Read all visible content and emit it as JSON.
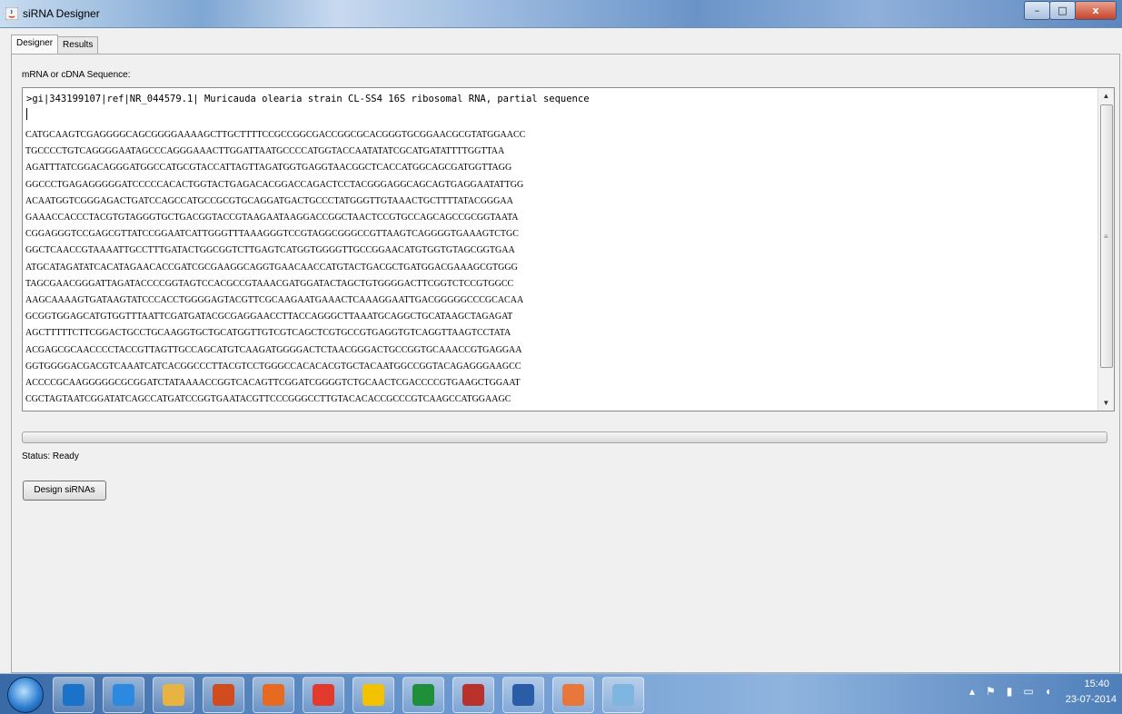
{
  "window": {
    "title": "siRNA Designer",
    "buttons": {
      "minimize": "–",
      "maximize": "□",
      "close": "x"
    }
  },
  "tabs": [
    {
      "label": "Designer",
      "active": true
    },
    {
      "label": "Results",
      "active": false
    }
  ],
  "sequence": {
    "label": "mRNA or cDNA Sequence:",
    "header": ">gi|343199107|ref|NR_044579.1| Muricauda olearia strain CL-SS4 16S ribosomal RNA, partial sequence",
    "lines": [
      "CATGCAAGTCGAGGGGCAGCGGGGAAAAGCTTGCTTTTCCGCCGGCGACCGGCGCACGGGTGCGGAACGCGTATGGAACC",
      "TGCCCCTGTCAGGGGAATAGCCCAGGGAAACTTGGATTAATGCCCCATGGTACCAATATATCGCATGATATTTTGGTTAA",
      "AGATTTATCGGACAGGGATGGCCATGCGTACCATTAGTTAGATGGTGAGGTAACGGCTCACCATGGCAGCGATGGTTAGG",
      "GGCCCTGAGAGGGGGATCCCCCACACTGGTACTGAGACACGGACCAGACTCCTACGGGAGGCAGCAGTGAGGAATATTGG",
      "ACAATGGTCGGGAGACTGATCCAGCCATGCCGCGTGCAGGATGACTGCCCTATGGGTTGTAAACTGCTTTTATACGGGAA",
      "GAAACCACCCTACGTGTAGGGTGCTGACGGTACCGTAAGAATAAGGACCGGCTAACTCCGTGCCAGCAGCCGCGGTAATA",
      "CGGAGGGTCCGAGCGTTATCCGGAATCATTGGGTTTAAAGGGTCCGTAGGCGGGCCGTTAAGTCAGGGGTGAAAGTCTGC",
      "GGCTCAACCGTAAAATTGCCTTTGATACTGGCGGTCTTGAGTCATGGTGGGGTTGCCGGAACATGTGGTGTAGCGGTGAA",
      "ATGCATAGATATCACATAGAACACCGATCGCGAAGGCAGGTGAACAACCATGTACTGACGCTGATGGACGAAAGCGTGGG",
      "TAGCGAACGGGATTAGATACCCCGGTAGTCCACGCCGTAAACGATGGATACTAGCTGTGGGGACTTCGGTCTCCGTGGCC",
      "AAGCAAAAGTGATAAGTATCCCACCTGGGGAGTACGTTCGCAAGAATGAAACTCAAAGGAATTGACGGGGGCCCGCACAA",
      "GCGGTGGAGCATGTGGTTTAATTCGATGATACGCGAGGAACCTTACCAGGGCTTAAATGCAGGCTGCATAAGCTAGAGAT",
      "AGCTTTTTCTTCGGACTGCCTGCAAGGTGCTGCATGGTTGTCGTCAGCTCGTGCCGTGAGGTGTCAGGTTAAGTCCTATA",
      "ACGAGCGCAACCCCTACCGTTAGTTGCCAGCATGTCAAGATGGGGACTCTAACGGGACTGCCGGTGCAAACCGTGAGGAA",
      "GGTGGGGACGACGTCAAATCATCACGGCCCTTACGTCCTGGGCCACACACGTGCTACAATGGCCGGTACAGAGGGAAGCC",
      "ACCCCGCAAGGGGGCGCGGATCTATAAAACCGGTCACAGTTCGGATCGGGGTCTGCAACTCGACCCCGTGAAGCTGGAAT",
      "CGCTAGTAATCGGATATCAGCCATGATCCGGTGAATACGTTCCCGGGCCTTGTACACACCGCCCGTCAAGCCATGGAAGC"
    ]
  },
  "progress": {
    "percent": 0
  },
  "status": {
    "text": "Status: Ready"
  },
  "actions": {
    "design_label": "Design siRNAs"
  },
  "taskbar": {
    "apps": [
      "media-player",
      "internet-explorer",
      "file-explorer",
      "powerpoint",
      "firefox",
      "chrome",
      "outlook",
      "excel",
      "access",
      "word",
      "java",
      "notepad"
    ],
    "clock": {
      "time": "15:40",
      "date": "23-07-2014"
    }
  },
  "colors": {
    "accent": "#6a94c8",
    "taskbar": "#4f7fba"
  }
}
